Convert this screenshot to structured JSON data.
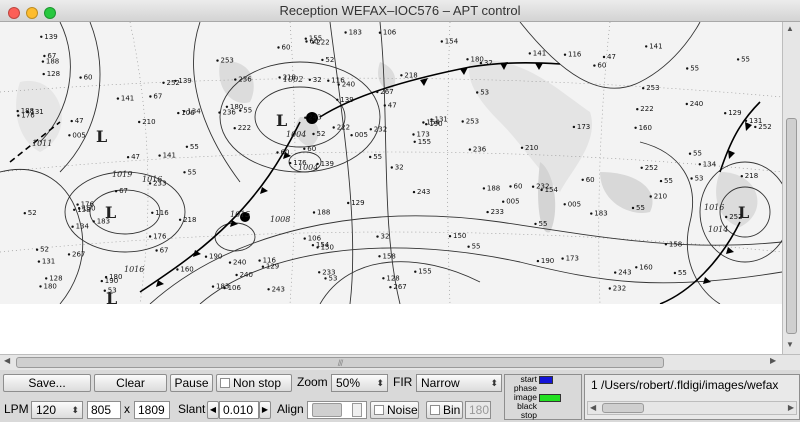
{
  "window": {
    "title": "Reception WEFAX–IOC576 – APT control"
  },
  "map": {
    "pressure_labels": [
      "1002",
      "1004",
      "1004",
      "1008",
      "1015",
      "1016",
      "1019",
      "1016",
      "1014",
      "1011",
      "1016"
    ],
    "low_markers": [
      "L",
      "L",
      "L",
      "L",
      "L"
    ],
    "station_samples": [
      "55",
      "005",
      "55",
      "176",
      "53",
      "180",
      "32",
      "47",
      "183",
      "55",
      "131",
      "67",
      "116",
      "190",
      "154",
      "60",
      "222",
      "252",
      "188",
      "240",
      "60",
      "106",
      "52",
      "139",
      "141",
      "218",
      "243",
      "158",
      "232",
      "267",
      "236",
      "210",
      "233",
      "160",
      "129",
      "173",
      "128",
      "150",
      "155",
      "134",
      "253"
    ]
  },
  "controls": {
    "save_label": "Save...",
    "clear_label": "Clear",
    "pause_label": "Pause",
    "nonstop_label": "Non stop",
    "zoom_label": "Zoom",
    "zoom_value": "50%",
    "fir_label": "FIR",
    "fir_value": "Narrow",
    "lpm_label": "LPM",
    "lpm_value": "120",
    "width_value": "805",
    "x_label": "x",
    "height_value": "1809",
    "slant_label": "Slant",
    "slant_value": "0.010",
    "align_label": "Align",
    "noise_label": "Noise",
    "bin_label": "Bin",
    "bin_value": "180"
  },
  "phase": {
    "labels": [
      "start",
      "phase",
      "image",
      "black",
      "stop"
    ],
    "start_color": "#1414d8",
    "image_color": "#22e022"
  },
  "file": {
    "path": "1 /Users/robert/.fldigi/images/wefax"
  },
  "icons": {
    "updown": "⬍",
    "left": "◀",
    "right": "▶",
    "up": "▲",
    "down": "▼",
    "grip": "///"
  }
}
